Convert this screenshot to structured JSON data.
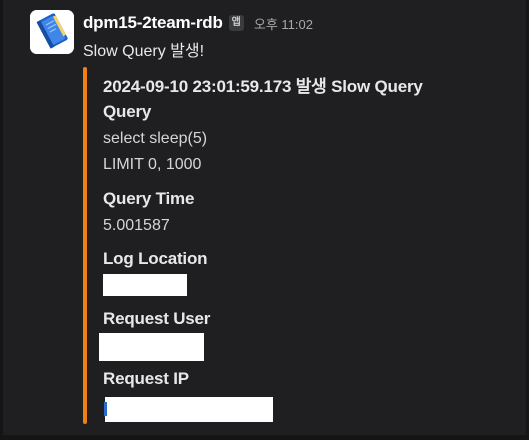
{
  "message": {
    "sender": "dpm15-2team-rdb",
    "app_badge": "앱",
    "timestamp": "오후 11:02",
    "text": "Slow Query 발생!",
    "avatar_icon": "notebook-icon"
  },
  "attachment": {
    "accent_color": "#f07f14",
    "title": "2024-09-10 23:01:59.173 발생 Slow Query",
    "fields": [
      {
        "label": "Query",
        "lines": [
          "select sleep(5)",
          "LIMIT 0, 1000"
        ]
      },
      {
        "label": "Query Time",
        "lines": [
          "5.001587"
        ]
      },
      {
        "label": "Log Location",
        "lines": []
      },
      {
        "label": "Request User",
        "lines": []
      },
      {
        "label": "Request IP",
        "lines": []
      }
    ]
  }
}
